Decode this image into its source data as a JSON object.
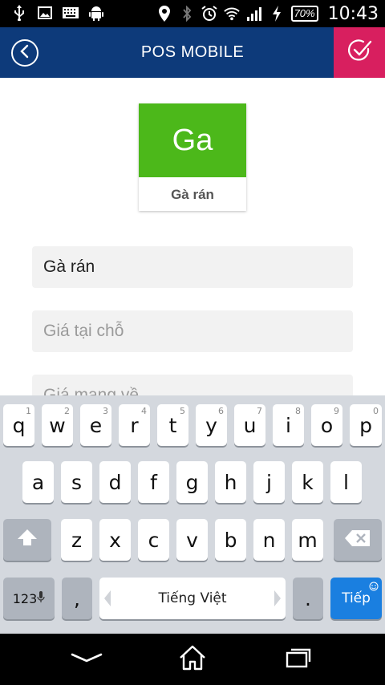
{
  "status_bar": {
    "left_icons": [
      "usb-icon",
      "image-icon",
      "keyboard-icon",
      "android-icon"
    ],
    "right_icons": [
      "location-icon",
      "bluetooth-icon",
      "alarm-icon",
      "wifi-icon",
      "signal-icon",
      "charging-icon"
    ],
    "battery": "70%",
    "time": "10:43"
  },
  "header": {
    "title": "POS MOBILE",
    "back_icon": "back-circle-icon",
    "confirm_icon": "check-circle-icon",
    "confirm_color": "#d81f5f",
    "bar_color": "#0d3a7a"
  },
  "item_tile": {
    "initials": "Ga",
    "name": "Gà rán",
    "color": "#4cb81a"
  },
  "form": {
    "name_value": "Gà rán",
    "price_here_placeholder": "Giá tại chỗ",
    "price_takeaway_placeholder": "Giá mang về"
  },
  "keyboard": {
    "row1": [
      {
        "key": "q",
        "num": "1"
      },
      {
        "key": "w",
        "num": "2"
      },
      {
        "key": "e",
        "num": "3"
      },
      {
        "key": "r",
        "num": "4"
      },
      {
        "key": "t",
        "num": "5"
      },
      {
        "key": "y",
        "num": "6"
      },
      {
        "key": "u",
        "num": "7"
      },
      {
        "key": "i",
        "num": "8"
      },
      {
        "key": "o",
        "num": "9"
      },
      {
        "key": "p",
        "num": "0"
      }
    ],
    "row2": [
      "a",
      "s",
      "d",
      "f",
      "g",
      "h",
      "j",
      "k",
      "l"
    ],
    "row3": [
      "z",
      "x",
      "c",
      "v",
      "b",
      "n",
      "m"
    ],
    "symbols_key": "123",
    "comma_key": ",",
    "space_label": "Tiếng Việt",
    "period_key": ".",
    "next_key": "Tiếp",
    "accent_color": "#1a7fe0"
  },
  "nav_bar": {
    "icons": [
      "back-chevron-icon",
      "home-icon",
      "recents-icon"
    ]
  }
}
